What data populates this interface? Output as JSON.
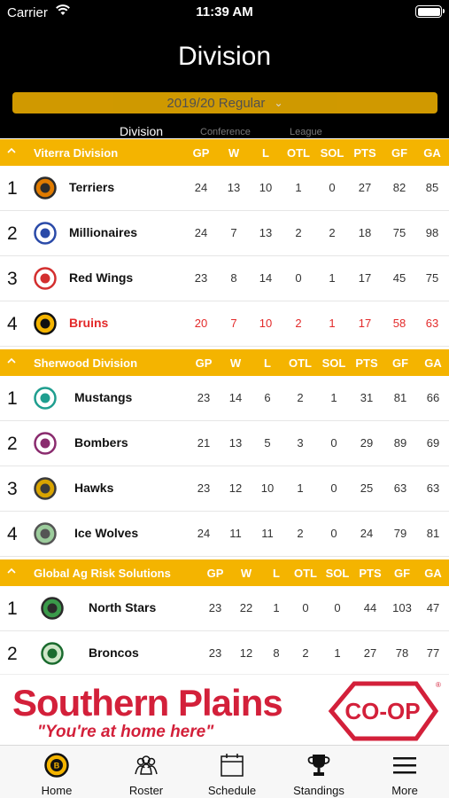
{
  "status_bar": {
    "carrier": "Carrier",
    "time": "11:39 AM"
  },
  "header": {
    "title": "Division"
  },
  "season_selector": {
    "label": "2019/20 Regular"
  },
  "segments": {
    "division": "Division",
    "conference": "Conference",
    "league": "League"
  },
  "columns": [
    "GP",
    "W",
    "L",
    "OTL",
    "SOL",
    "PTS",
    "GF",
    "GA"
  ],
  "colors": {
    "accent": "#f4b400",
    "highlight": "#e32a2a",
    "ad_red": "#d3203a"
  },
  "groups": [
    {
      "name": "Viterra Division",
      "teams": [
        {
          "rank": "1",
          "name": "Terriers",
          "logo": "terriers-logo",
          "stats": [
            "24",
            "13",
            "10",
            "1",
            "0",
            "27",
            "82",
            "85"
          ]
        },
        {
          "rank": "2",
          "name": "Millionaires",
          "logo": "millionaires-logo",
          "stats": [
            "24",
            "7",
            "13",
            "2",
            "2",
            "18",
            "75",
            "98"
          ]
        },
        {
          "rank": "3",
          "name": "Red Wings",
          "logo": "red-wings-logo",
          "stats": [
            "23",
            "8",
            "14",
            "0",
            "1",
            "17",
            "45",
            "75"
          ]
        },
        {
          "rank": "4",
          "name": "Bruins",
          "logo": "bruins-logo",
          "highlight": true,
          "stats": [
            "20",
            "7",
            "10",
            "2",
            "1",
            "17",
            "58",
            "63"
          ]
        }
      ]
    },
    {
      "name": "Sherwood Division",
      "teams": [
        {
          "rank": "1",
          "name": "Mustangs",
          "logo": "mustangs-logo",
          "stats": [
            "23",
            "14",
            "6",
            "2",
            "1",
            "31",
            "81",
            "66"
          ]
        },
        {
          "rank": "2",
          "name": "Bombers",
          "logo": "bombers-logo",
          "stats": [
            "21",
            "13",
            "5",
            "3",
            "0",
            "29",
            "89",
            "69"
          ]
        },
        {
          "rank": "3",
          "name": "Hawks",
          "logo": "hawks-logo",
          "stats": [
            "23",
            "12",
            "10",
            "1",
            "0",
            "25",
            "63",
            "63"
          ]
        },
        {
          "rank": "4",
          "name": "Ice Wolves",
          "logo": "ice-wolves-logo",
          "stats": [
            "24",
            "11",
            "11",
            "2",
            "0",
            "24",
            "79",
            "81"
          ]
        }
      ]
    },
    {
      "name": "Global Ag Risk Solutions",
      "teams": [
        {
          "rank": "1",
          "name": "North Stars",
          "logo": "north-stars-logo",
          "stats": [
            "23",
            "22",
            "1",
            "0",
            "0",
            "44",
            "103",
            "47"
          ]
        },
        {
          "rank": "2",
          "name": "Broncos",
          "logo": "broncos-logo",
          "stats": [
            "23",
            "12",
            "8",
            "2",
            "1",
            "27",
            "78",
            "77"
          ]
        }
      ]
    }
  ],
  "ad": {
    "brand": "Southern Plains",
    "tagline": "\"You're at home here\"",
    "badge": "CO-OP"
  },
  "tabs": [
    {
      "label": "Home",
      "icon": "bruins-logo-icon"
    },
    {
      "label": "Roster",
      "icon": "people-icon"
    },
    {
      "label": "Schedule",
      "icon": "calendar-icon"
    },
    {
      "label": "Standings",
      "icon": "trophy-icon"
    },
    {
      "label": "More",
      "icon": "menu-icon"
    }
  ]
}
